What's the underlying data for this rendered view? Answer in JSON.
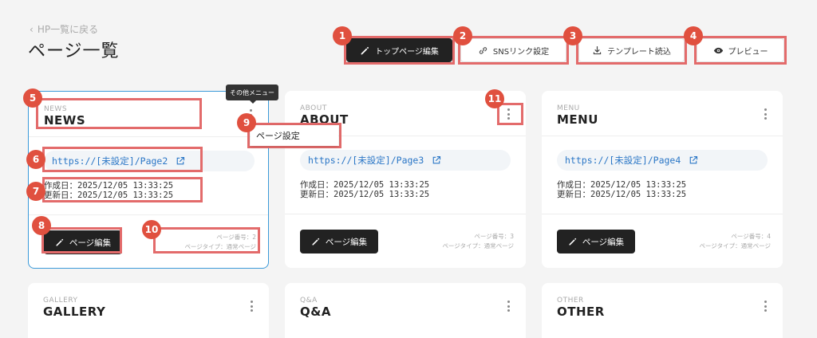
{
  "header": {
    "back_label": "HP一覧に戻る",
    "title": "ページ一覧"
  },
  "toolbar": {
    "top_edit": "トップページ編集",
    "sns": "SNSリンク設定",
    "template": "テンプレート読込",
    "preview": "プレビュー"
  },
  "tooltip": "その他メニュー",
  "dropdown": {
    "page_settings": "ページ設定"
  },
  "labels": {
    "edit_button": "ページ編集"
  },
  "badges": [
    "1",
    "2",
    "3",
    "4",
    "5",
    "6",
    "7",
    "8",
    "9",
    "10",
    "11"
  ],
  "cards": [
    {
      "cat": "NEWS",
      "name": "NEWS",
      "url": "https://[未設定]/Page2",
      "created": "作成日：2025/12/05 13:33:25",
      "updated": "更新日：2025/12/05 13:33:25",
      "page_no": "ページ番号：2",
      "page_type": "ページタイプ：通常ページ"
    },
    {
      "cat": "ABOUT",
      "name": "ABOUT",
      "url": "https://[未設定]/Page3",
      "created": "作成日：2025/12/05 13:33:25",
      "updated": "更新日：2025/12/05 13:33:25",
      "page_no": "ページ番号：3",
      "page_type": "ページタイプ：通常ページ"
    },
    {
      "cat": "MENU",
      "name": "MENU",
      "url": "https://[未設定]/Page4",
      "created": "作成日：2025/12/05 13:33:25",
      "updated": "更新日：2025/12/05 13:33:25",
      "page_no": "ページ番号：4",
      "page_type": "ページタイプ：通常ページ"
    },
    {
      "cat": "GALLERY",
      "name": "GALLERY"
    },
    {
      "cat": "Q&A",
      "name": "Q&A"
    },
    {
      "cat": "OTHER",
      "name": "OTHER"
    }
  ],
  "colors": {
    "accent": "#e0503f",
    "highlight": "#e36b6b",
    "link": "#2a76c6",
    "active_border": "#3b9ad9",
    "dark_button": "#222222"
  }
}
